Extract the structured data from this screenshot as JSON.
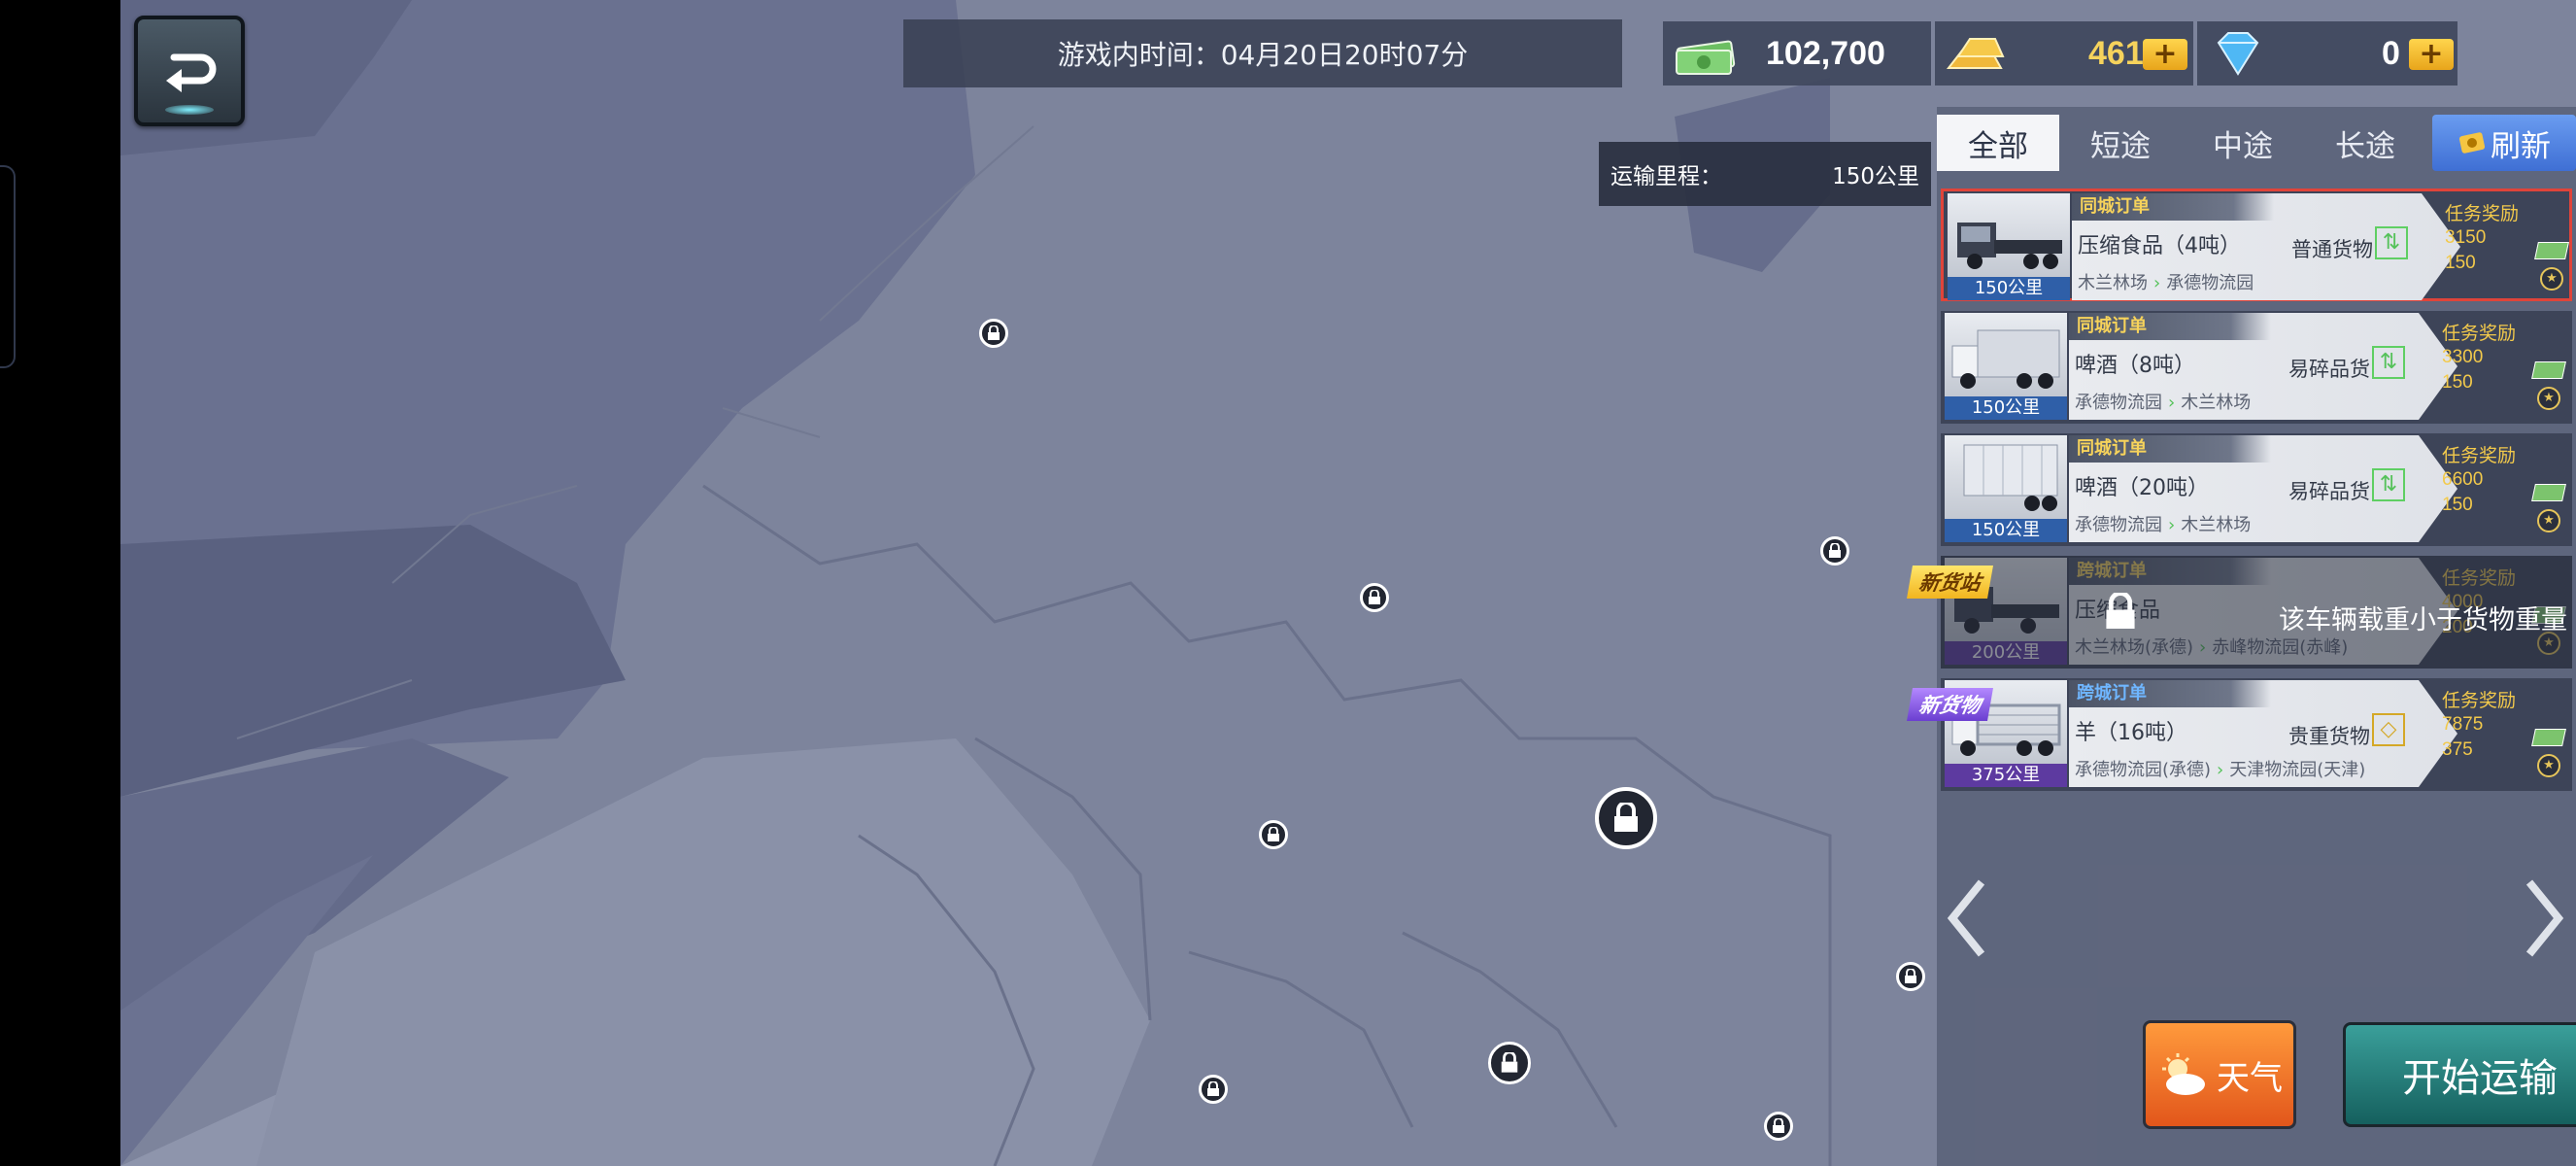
{
  "top": {
    "game_time": "游戏内时间：04月20日20时07分",
    "cash": "102,700",
    "gold": "461",
    "diamond": "0",
    "plus": "+"
  },
  "route": {
    "label": "运输里程：",
    "value": "150公里"
  },
  "tabs": [
    "全部",
    "短途",
    "中途",
    "长途"
  ],
  "refresh_label": "刷新",
  "orders": [
    {
      "type": "同城订单",
      "cargo": "压缩食品（4吨）",
      "cargo_type": "普通货物",
      "from": "木兰林场",
      "to": "承德物流园",
      "distance": "150公里",
      "reward_label": "任务奖励",
      "cash": "3150",
      "exp": "150"
    },
    {
      "type": "同城订单",
      "cargo": "啤酒（8吨）",
      "cargo_type": "易碎品货",
      "from": "承德物流园",
      "to": "木兰林场",
      "distance": "150公里",
      "reward_label": "任务奖励",
      "cash": "3300",
      "exp": "150"
    },
    {
      "type": "同城订单",
      "cargo": "啤酒（20吨）",
      "cargo_type": "易碎品货",
      "from": "承德物流园",
      "to": "木兰林场",
      "distance": "150公里",
      "reward_label": "任务奖励",
      "cash": "6600",
      "exp": "150"
    },
    {
      "type": "跨城订单",
      "cargo": "压缩食品",
      "cargo_type": "",
      "from": "木兰林场(承德)",
      "to": "赤峰物流园(赤峰)",
      "distance": "200公里",
      "reward_label": "任务奖励",
      "cash": "4000",
      "exp": "200",
      "tag": "新货站",
      "locked_message": "该车辆载重小于货物重量"
    },
    {
      "type": "跨城订单",
      "cargo": "羊（16吨）",
      "cargo_type": "贵重货物",
      "from": "承德物流园(承德)",
      "to": "天津物流园(天津)",
      "distance": "375公里",
      "reward_label": "任务奖励",
      "cash": "7875",
      "exp": "375",
      "tag": "新货物"
    }
  ],
  "weather_label": "天气",
  "start_label": "开始运输"
}
